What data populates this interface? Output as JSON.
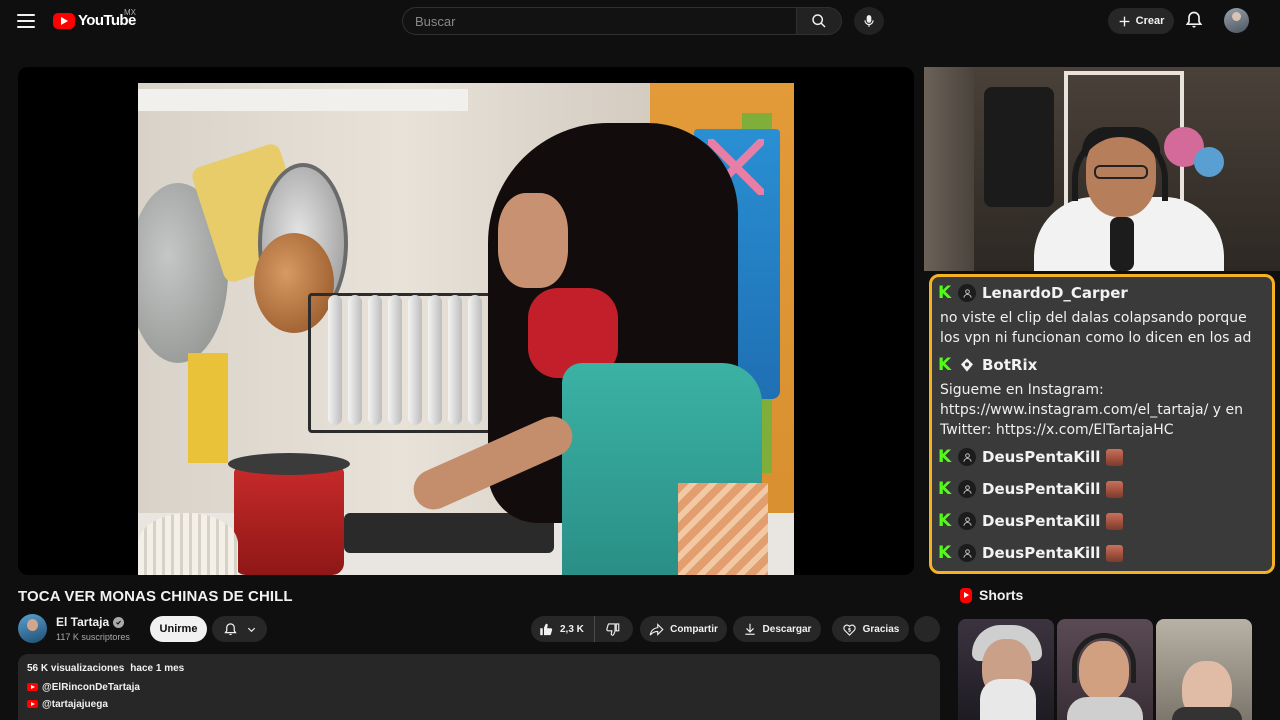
{
  "header": {
    "logo_text": "YouTube",
    "country": "MX",
    "search_placeholder": "Buscar",
    "create_label": "Crear"
  },
  "video": {
    "title": "TOCA VER MONAS CHINAS DE CHILL"
  },
  "channel": {
    "name": "El Tartaja",
    "subscribers": "117 K suscriptores",
    "join_label": "Unirme"
  },
  "actions": {
    "likes": "2,3 K",
    "share_label": "Compartir",
    "download_label": "Descargar",
    "thanks_label": "Gracias"
  },
  "description": {
    "views": "56 K visualizaciones",
    "date": "hace 1 mes",
    "links": [
      "@ElRinconDeTartaja",
      "@tartajajuega"
    ]
  },
  "chat": {
    "accent": "#f5b324",
    "platform_color": "#53fc18",
    "messages": [
      {
        "user": "LenardoD_Carper",
        "badge": "user",
        "text": "no viste el clip del dalas colapsando porque los vpn ni funcionan como lo dicen en los ad",
        "emote": false
      },
      {
        "user": "BotRix",
        "badge": "bot",
        "text": "Sigueme en Instagram: https://www.instagram.com/el_tartaja/ y en Twitter: https://x.com/ElTartajaHC",
        "emote": false
      },
      {
        "user": "DeusPentaKill",
        "badge": "user",
        "text": "",
        "emote": true
      },
      {
        "user": "DeusPentaKill",
        "badge": "user",
        "text": "",
        "emote": true
      },
      {
        "user": "DeusPentaKill",
        "badge": "user",
        "text": "",
        "emote": true
      },
      {
        "user": "DeusPentaKill",
        "badge": "user",
        "text": "",
        "emote": true
      }
    ]
  },
  "shorts": {
    "title": "Shorts"
  }
}
